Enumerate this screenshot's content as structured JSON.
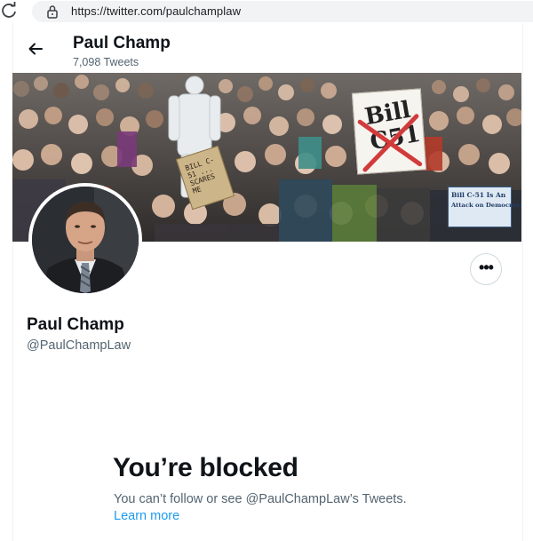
{
  "browser": {
    "url": "https://twitter.com/paulchamplaw"
  },
  "header": {
    "name": "Paul Champ",
    "tweet_count": "7,098 Tweets"
  },
  "banner": {
    "sign_big_line1": "Bill",
    "sign_big_line2": "C51",
    "sign_blue_line1": "Bill C-51 Is An",
    "sign_blue_line2": "Attack on Democracy!",
    "sign_card_text": "BILL C-51 ... SCARES ME"
  },
  "profile": {
    "name": "Paul Champ",
    "handle": "@PaulChampLaw"
  },
  "blocked": {
    "title": "You’re blocked",
    "description": "You can’t follow or see @PaulChampLaw’s Tweets.",
    "learn_more": "Learn more"
  },
  "colors": {
    "link": "#1d9bf0",
    "secondary_text": "#536471",
    "primary_text": "#0f1419"
  }
}
